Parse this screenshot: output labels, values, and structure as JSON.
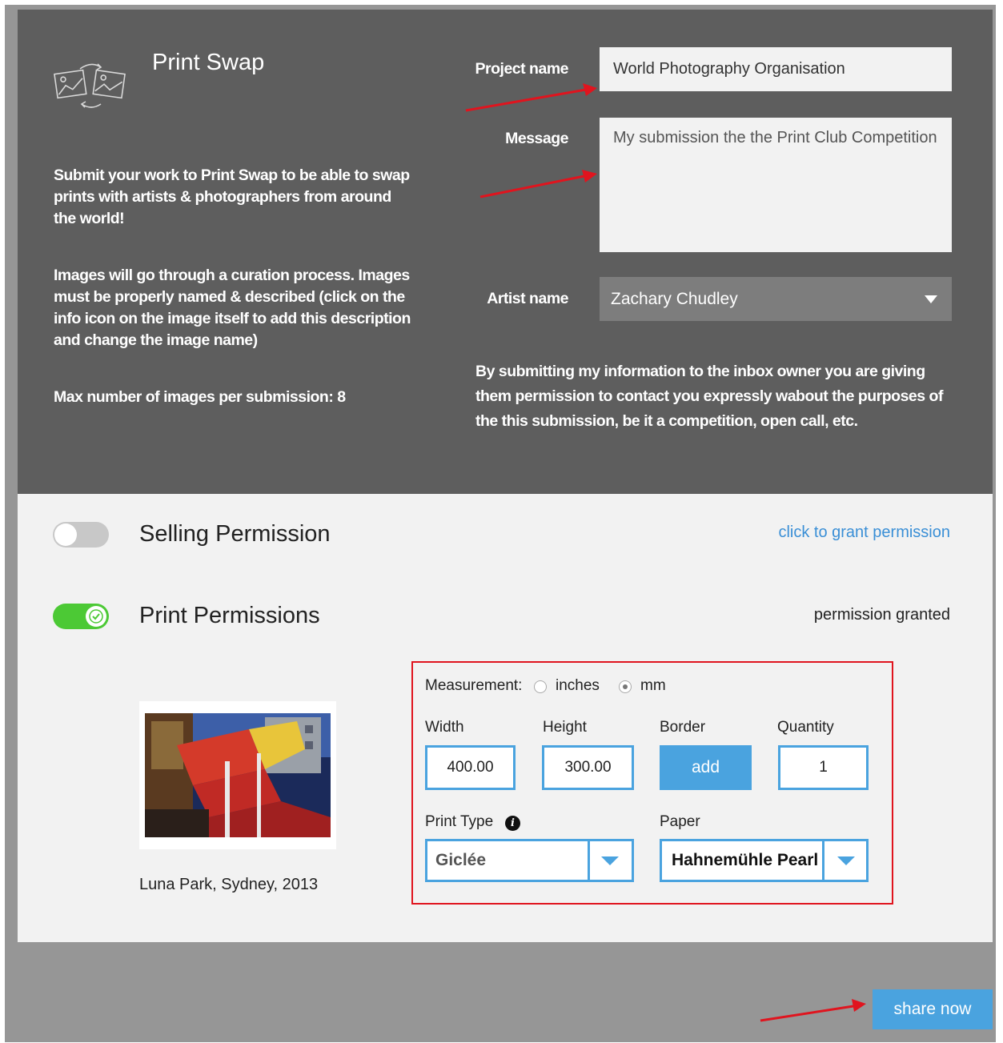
{
  "header": {
    "app_title": "Print Swap"
  },
  "intro": {
    "paragraph1": "Submit your work to Print Swap to be able to swap prints with artists & photographers from around the world!",
    "paragraph2": "Images will go through a curation process. Images must be properly named & described (click on the info icon on the image itself to add this description and change the image name)",
    "paragraph3": "Max number of images per submission: 8"
  },
  "form": {
    "project_name_label": "Project name",
    "project_name_value": "World Photography Organisation",
    "message_label": "Message",
    "message_value": "My submission the the Print Club Competition",
    "artist_name_label": "Artist name",
    "artist_name_value": "Zachary Chudley",
    "consent_text": "By submitting my information to the inbox owner you are giving them permission to contact you expressly wabout the purposes of the this submission, be it a competition, open call, etc."
  },
  "permissions": {
    "selling": {
      "title": "Selling Permission",
      "enabled": false,
      "status": "click to grant permission"
    },
    "print": {
      "title": "Print Permissions",
      "enabled": true,
      "status": "permission granted"
    }
  },
  "image": {
    "caption": "Luna Park, Sydney, 2013"
  },
  "print_options": {
    "measurement_label": "Measurement:",
    "units": [
      {
        "label": "inches",
        "selected": false
      },
      {
        "label": "mm",
        "selected": true
      }
    ],
    "width_label": "Width",
    "width_value": "400.00",
    "height_label": "Height",
    "height_value": "300.00",
    "border_label": "Border",
    "border_button": "add",
    "quantity_label": "Quantity",
    "quantity_value": "1",
    "print_type_label": "Print Type",
    "print_type_value": "Giclée",
    "paper_label": "Paper",
    "paper_value": "Hahnemühle Pearl"
  },
  "footer": {
    "share_button": "share now"
  },
  "colors": {
    "dark_panel": "#5e5e5e",
    "light_panel": "#f2f2f2",
    "accent_blue": "#4aa3df",
    "toggle_on": "#4cc935",
    "annotation_red": "#e0141e",
    "link_blue": "#3a8fd6"
  }
}
